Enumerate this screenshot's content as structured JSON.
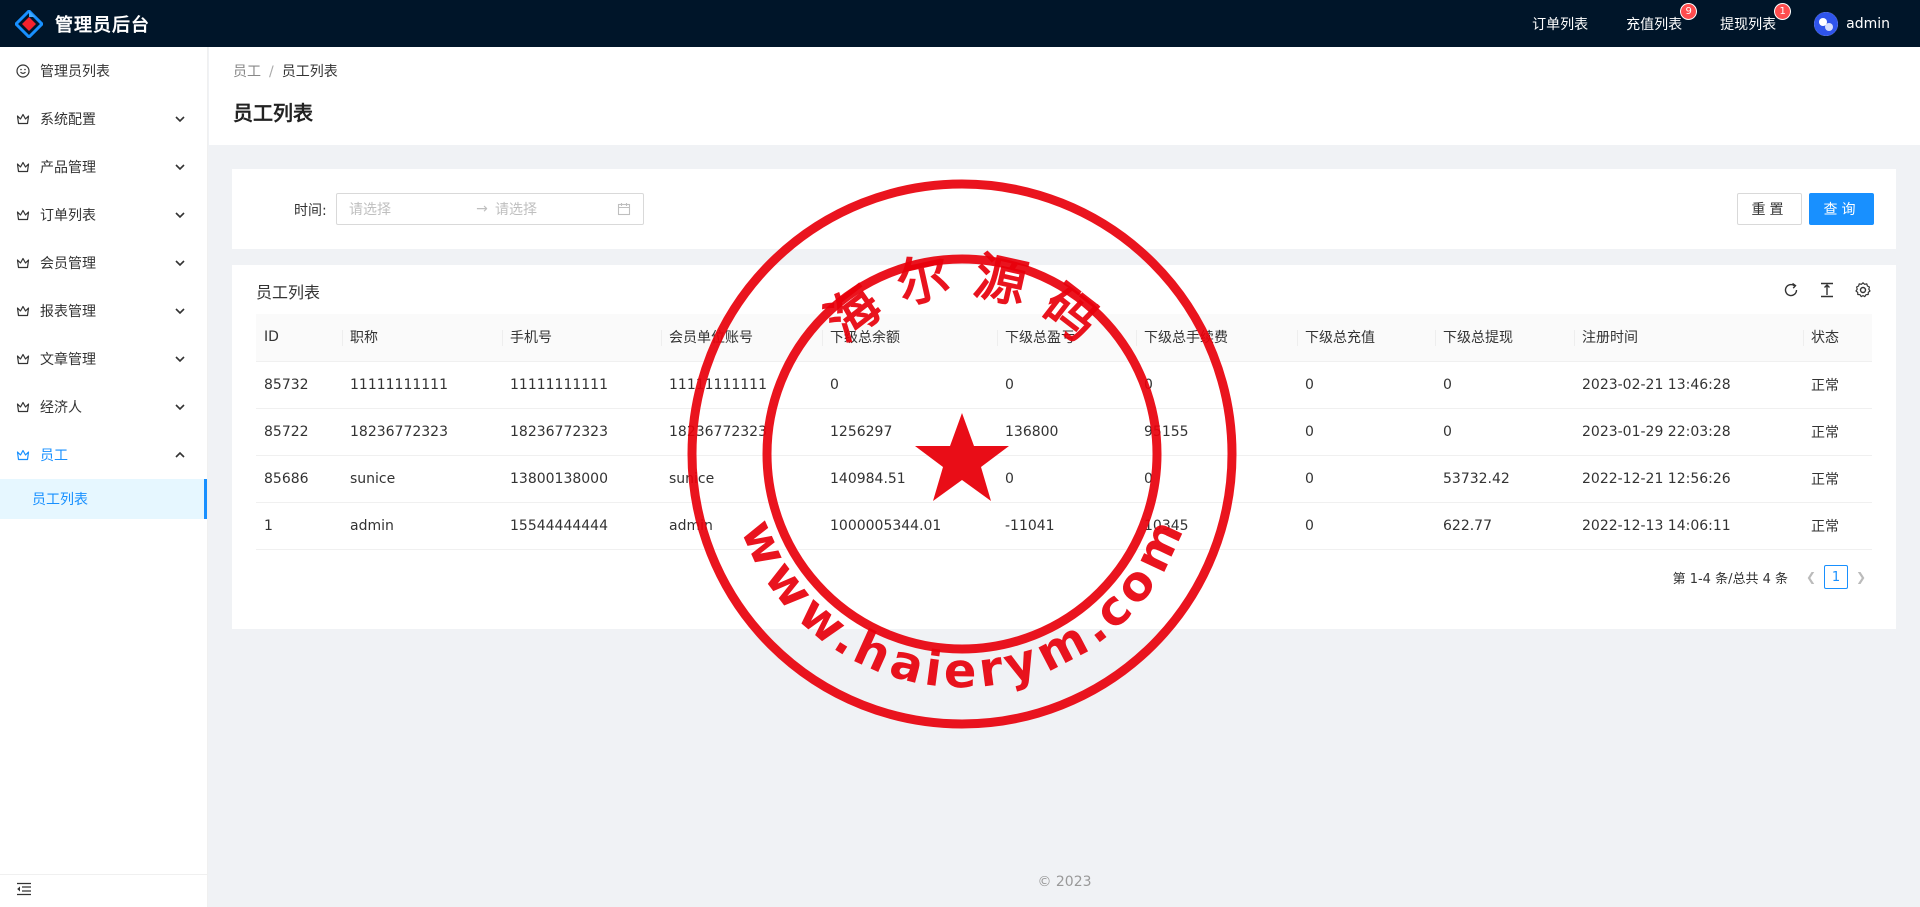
{
  "header": {
    "title": "管理员后台",
    "nav": [
      {
        "label": "订单列表",
        "badge": ""
      },
      {
        "label": "充值列表",
        "badge": "9"
      },
      {
        "label": "提现列表",
        "badge": "1"
      }
    ],
    "user": "admin"
  },
  "sidebar": {
    "items": [
      {
        "label": "管理员列表"
      },
      {
        "label": "系统配置"
      },
      {
        "label": "产品管理"
      },
      {
        "label": "订单列表"
      },
      {
        "label": "会员管理"
      },
      {
        "label": "报表管理"
      },
      {
        "label": "文章管理"
      },
      {
        "label": "经济人"
      },
      {
        "label": "员工"
      }
    ],
    "submenu": {
      "label": "员工列表"
    }
  },
  "breadcrumb": {
    "parent": "员工",
    "sep": "/",
    "current": "员工列表"
  },
  "page_title": "员工列表",
  "search": {
    "label": "时间:",
    "start_placeholder": "请选择",
    "end_placeholder": "请选择",
    "arrow": "→",
    "reset_label": "重置",
    "query_label": "查询"
  },
  "table": {
    "title": "员工列表",
    "columns": [
      "ID",
      "职称",
      "手机号",
      "会员单位账号",
      "下级总余额",
      "下级总盈亏",
      "下级总手续费",
      "下级总充值",
      "下级总提现",
      "注册时间",
      "状态"
    ],
    "rows": [
      [
        "85732",
        "11111111111",
        "11111111111",
        "11111111111",
        "0",
        "0",
        "0",
        "0",
        "0",
        "2023-02-21 13:46:28",
        "正常"
      ],
      [
        "85722",
        "18236772323",
        "18236772323",
        "18236772323",
        "1256297",
        "136800",
        "95155",
        "0",
        "0",
        "2023-01-29 22:03:28",
        "正常"
      ],
      [
        "85686",
        "sunice",
        "13800138000",
        "sunice",
        "140984.51",
        "0",
        "0",
        "0",
        "53732.42",
        "2022-12-21 12:56:26",
        "正常"
      ],
      [
        "1",
        "admin",
        "15544444444",
        "admin",
        "1000005344.01",
        "-11041",
        "10345",
        "0",
        "622.77",
        "2022-12-13 14:06:11",
        "正常"
      ]
    ]
  },
  "pager": {
    "summary": "第 1-4 条/总共 4 条",
    "page": "1"
  },
  "footer": "© 2023",
  "stamp": {
    "top_text": "海 尔 源 码",
    "bottom_text": "www.haierym.com",
    "color": "#e8000b"
  },
  "colors": {
    "accent": "#1890ff",
    "header_bg": "#001529",
    "badge": "#ff4d4f"
  }
}
